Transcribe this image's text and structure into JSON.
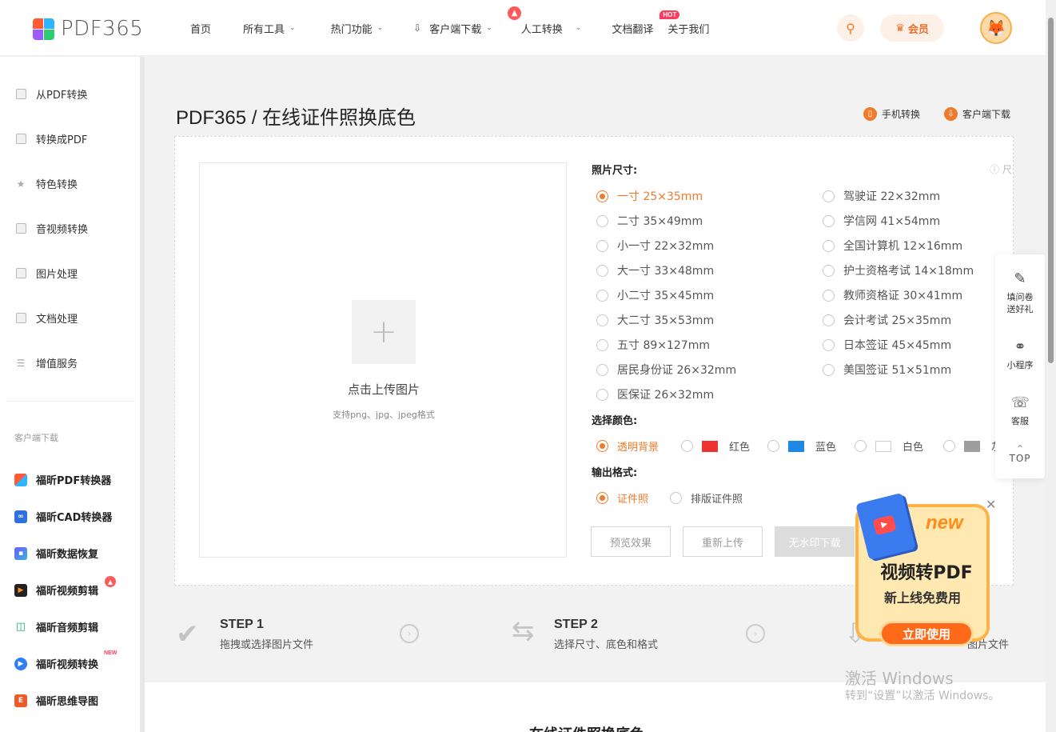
{
  "header": {
    "logo_text": "PDF365",
    "nav": [
      {
        "label": "首页",
        "dropdown": false
      },
      {
        "label": "所有工具",
        "dropdown": true
      },
      {
        "label": "热门功能",
        "dropdown": true
      },
      {
        "label": "客户端下载",
        "dropdown": true
      },
      {
        "label": "人工转换",
        "dropdown": true
      },
      {
        "label": "文档翻译",
        "dropdown": false,
        "badge": "HOT"
      },
      {
        "label": "关于我们",
        "dropdown": false
      }
    ],
    "vip_label": "会员"
  },
  "sidebar": {
    "items": [
      {
        "label": "从PDF转换",
        "icon": "pdf-from-icon"
      },
      {
        "label": "转换成PDF",
        "icon": "pdf-to-icon"
      },
      {
        "label": "特色转换",
        "icon": "star-icon"
      },
      {
        "label": "音视频转换",
        "icon": "media-icon"
      },
      {
        "label": "图片处理",
        "icon": "image-icon"
      },
      {
        "label": "文档处理",
        "icon": "document-icon"
      },
      {
        "label": "增值服务",
        "icon": "service-icon"
      }
    ],
    "section_label": "客户端下载",
    "apps": [
      {
        "label": "福昕PDF转换器",
        "color": "#f05a28"
      },
      {
        "label": "福昕CAD转换器",
        "color": "#2f6fe0"
      },
      {
        "label": "福昕数据恢复",
        "color": "#3bb26a"
      },
      {
        "label": "福昕视频剪辑",
        "color": "#333333"
      },
      {
        "label": "福昕音频剪辑",
        "color": "#22b35e"
      },
      {
        "label": "福昕视频转换",
        "color": "#2f7ef5",
        "tag": "NEW"
      },
      {
        "label": "福昕思维导图",
        "color": "#f05a28"
      }
    ]
  },
  "main": {
    "title": "PDF365 / 在线证件照换底色",
    "links": [
      {
        "label": "手机转换",
        "icon": "phone-icon"
      },
      {
        "label": "客户端下载",
        "icon": "download-icon"
      }
    ],
    "upload": {
      "title": "点击上传图片",
      "hint": "支持png、jpg、jpeg格式"
    },
    "size_label": "照片尺寸:",
    "help_text": "尺",
    "sizes_left": [
      {
        "label": "一寸 25×35mm",
        "selected": true
      },
      {
        "label": "二寸 35×49mm",
        "selected": false
      },
      {
        "label": "小一寸 22×32mm",
        "selected": false
      },
      {
        "label": "大一寸 33×48mm",
        "selected": false
      },
      {
        "label": "小二寸 35×45mm",
        "selected": false
      },
      {
        "label": "大二寸 35×53mm",
        "selected": false
      },
      {
        "label": "五寸 89×127mm",
        "selected": false
      },
      {
        "label": "居民身份证 26×32mm",
        "selected": false
      },
      {
        "label": "医保证 26×32mm",
        "selected": false
      }
    ],
    "sizes_right": [
      {
        "label": "驾驶证 22×32mm",
        "selected": false
      },
      {
        "label": "学信网 41×54mm",
        "selected": false
      },
      {
        "label": "全国计算机 12×16mm",
        "selected": false
      },
      {
        "label": "护士资格考试 14×18mm",
        "selected": false
      },
      {
        "label": "教师资格证 30×41mm",
        "selected": false
      },
      {
        "label": "会计考试 25×35mm",
        "selected": false
      },
      {
        "label": "日本签证 45×45mm",
        "selected": false
      },
      {
        "label": "美国签证 51×51mm",
        "selected": false
      }
    ],
    "color_label": "选择颜色:",
    "colors": [
      {
        "label": "透明背景",
        "swatch": null,
        "selected": true
      },
      {
        "label": "红色",
        "swatch": "#ee3333",
        "selected": false
      },
      {
        "label": "蓝色",
        "swatch": "#1e88e5",
        "selected": false
      },
      {
        "label": "白色",
        "swatch": "#ffffff",
        "selected": false
      },
      {
        "label": "灰",
        "swatch": "#9e9e9e",
        "selected": false
      }
    ],
    "format_label": "输出格式:",
    "formats": [
      {
        "label": "证件照",
        "selected": true
      },
      {
        "label": "排版证件照",
        "selected": false
      }
    ],
    "buttons": {
      "preview": "预览效果",
      "reupload": "重新上传",
      "download": "无水印下载"
    }
  },
  "steps": [
    {
      "title": "STEP 1",
      "desc": "拖拽或选择图片文件"
    },
    {
      "title": "STEP 2",
      "desc": "选择尺寸、底色和格式"
    },
    {
      "desc_tail": "图片文件"
    }
  ],
  "bottom_heading": "在线证件照换底色",
  "float_bar": {
    "survey": "填问卷\n送好礼",
    "mini": "小程序",
    "service": "客服",
    "top": "TOP"
  },
  "promo": {
    "new": "new",
    "title": "视频转PDF",
    "subtitle": "新上线免费用",
    "cta": "立即使用"
  },
  "watermark": {
    "line1": "激活 Windows",
    "line2": "转到“设置”以激活 Windows。"
  }
}
